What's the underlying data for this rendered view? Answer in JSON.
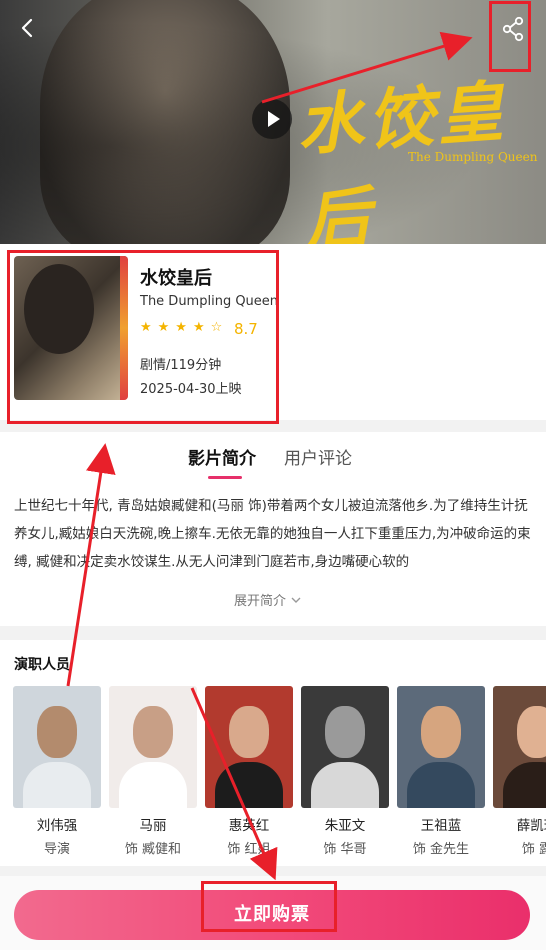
{
  "hero": {
    "title_cn": "水饺皇后",
    "title_en": "The Dumpling Queen"
  },
  "movie": {
    "title_cn": "水饺皇后",
    "title_en": "The Dumpling Queen",
    "stars": "★★★★☆",
    "star_rating": 4,
    "rating": "8.7",
    "genre_runtime": "剧情/119分钟",
    "release": "2025-04-30上映"
  },
  "tabs": [
    {
      "label": "影片简介",
      "active": true
    },
    {
      "label": "用户评论",
      "active": false
    }
  ],
  "synopsis": {
    "text": "上世纪七十年代, 青岛姑娘臧健和(马丽 饰)带着两个女儿被迫流落他乡.为了维持生计抚养女儿,臧姑娘白天洗碗,晚上擦车.无依无靠的她独自一人扛下重重压力,为冲破命运的束缚, 臧健和决定卖水饺谋生.从无人问津到门庭若市,身边嘴硬心软的",
    "expand_label": "展开简介"
  },
  "cast": {
    "title": "演职人员",
    "members": [
      {
        "name": "刘伟强",
        "role": "导演"
      },
      {
        "name": "马丽",
        "role": "饰 臧健和"
      },
      {
        "name": "惠英红",
        "role": "饰 红姐"
      },
      {
        "name": "朱亚文",
        "role": "饰 华哥"
      },
      {
        "name": "王祖蓝",
        "role": "饰 金先生"
      },
      {
        "name": "薛凯琪",
        "role": "饰 露"
      }
    ]
  },
  "actions": {
    "buy_label": "立即购票"
  },
  "colors": {
    "accent": "#e6306a",
    "star": "#f4b400",
    "annotation": "#e8202a",
    "hero_title": "#f0c419"
  },
  "icons": {
    "back": "chevron-left-icon",
    "share": "share-icon",
    "play": "play-icon",
    "expand": "chevron-down-icon"
  }
}
